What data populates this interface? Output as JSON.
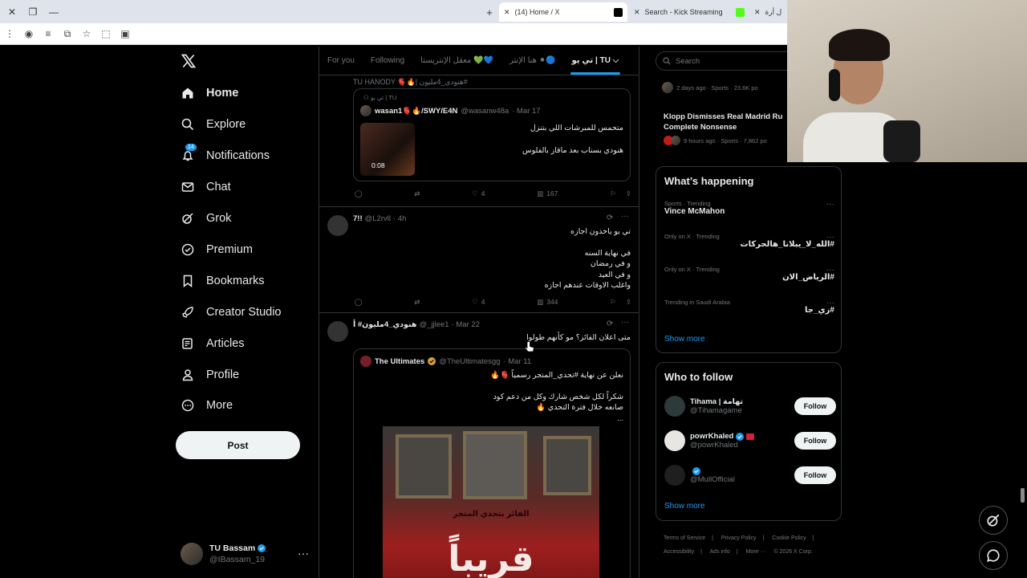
{
  "browser": {
    "tabs": [
      {
        "title": "(14) Home / X",
        "close": "✕"
      },
      {
        "title": "Search - Kick Streaming",
        "close": "✕"
      },
      {
        "title": "ل أرة",
        "close": "✕"
      }
    ],
    "new_tab": "+"
  },
  "nav": {
    "items": [
      {
        "label": "Home",
        "icon": "home-icon"
      },
      {
        "label": "Explore",
        "icon": "search-icon"
      },
      {
        "label": "Notifications",
        "icon": "bell-icon",
        "badge": "14"
      },
      {
        "label": "Chat",
        "icon": "mail-icon"
      },
      {
        "label": "Grok",
        "icon": "grok-icon"
      },
      {
        "label": "Premium",
        "icon": "premium-icon"
      },
      {
        "label": "Bookmarks",
        "icon": "bookmark-icon"
      },
      {
        "label": "Creator Studio",
        "icon": "rocket-icon"
      },
      {
        "label": "Articles",
        "icon": "articles-icon"
      },
      {
        "label": "Profile",
        "icon": "person-icon"
      },
      {
        "label": "More",
        "icon": "more-circle-icon"
      }
    ],
    "post_label": "Post",
    "account": {
      "name": "TU Bassam",
      "handle": "@IBassam_19"
    }
  },
  "timeline": {
    "tabs": [
      "For you",
      "Following",
      "معقل الإنتريستا 💚💙",
      "هنا الإنتر ⚫🔵",
      "تي يو | TU"
    ],
    "post1": {
      "header": "TU HANODY 🫀🔥| هنودي_4مليون#",
      "quote_context": "تي يو | TU",
      "quote_name": "wasan1🫀🔥/SWY/E4N",
      "quote_handle": "@wasanw48a",
      "quote_date": "· Mar 17",
      "quote_lines": [
        "متحمس للمبرشات اللي بتنزل",
        "هنودي بسناب بعد ماقاز بالفلوس"
      ],
      "video_time": "0:08",
      "likes": "4",
      "views": "167"
    },
    "post2": {
      "name": "7!!",
      "handle": "@L2rvll",
      "time": "· 4h",
      "lines": [
        "تي يو ياخذون اجازه",
        "",
        "في نهاية السنه",
        "و في رمضان",
        "و في العيد",
        "واغلب الاوقات عندهم اجازه"
      ],
      "likes": "4",
      "views": "344"
    },
    "post3": {
      "name": "هنودي_4مليون# أ",
      "handle": "@_jjlee1",
      "time": "· Mar 22",
      "text": "متى اعلان الفائز؟ مو كأنهم طولوا",
      "quote_name": "The Ultimates",
      "quote_handle": "@TheUltimatesgg",
      "quote_date": "· Mar 11",
      "quote_lines": [
        "نعلن عن نهاية #تحدي_المتجر رسمياً 🫀🔥",
        "",
        "شكراً لكل شخص شارك وكل من دعم كود",
        "صانعه خلال فترة التحدي 🔥",
        "..."
      ],
      "image_caption": "الفائز بتحدي المتجر",
      "image_big": "قريباً"
    }
  },
  "sidebar": {
    "search_placeholder": "Search",
    "news": [
      {
        "meta": "2 days ago · Sports · 23.6K po"
      },
      {
        "title": "Klopp Dismisses Real Madrid Ru",
        "title2": "Complete Nonsense",
        "meta": "9 hours ago · Sports · 7,862 po"
      }
    ],
    "happening": {
      "title": "What’s happening",
      "trends": [
        {
          "meta": "Sports · Trending",
          "name": "Vince McMahon"
        },
        {
          "meta": "Only on X · Trending",
          "name": "#الله_لا_يبلانا_هالحركات"
        },
        {
          "meta": "Only on X · Trending",
          "name": "#الرياض_الان"
        },
        {
          "meta": "Trending in Saudi Arabia",
          "name": "#زي_جا"
        }
      ],
      "show_more": "Show more"
    },
    "who_to_follow": {
      "title": "Who to follow",
      "users": [
        {
          "name": "Tihama | تهامة",
          "handle": "@Tihamagame",
          "button": "Follow"
        },
        {
          "name": "powrKhaled",
          "handle": "@powrKhaled",
          "button": "Follow"
        },
        {
          "name": "",
          "handle": "@MullOfficial",
          "button": "Follow"
        }
      ],
      "show_more": "Show more"
    },
    "footer": [
      "Terms of Service",
      "|",
      "Privacy Policy",
      "|",
      "Cookie Policy",
      "|",
      "Accessibility",
      "|",
      "Ads info",
      "|",
      "More ···",
      "© 2026 X Corp."
    ]
  },
  "colors": {
    "accent": "#1d9bf0",
    "bg": "#000000",
    "text": "#e7e9ea",
    "muted": "#71767b",
    "border": "#2f3336"
  }
}
